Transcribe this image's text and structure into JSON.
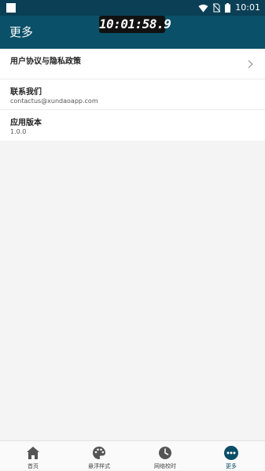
{
  "status_bar": {
    "time": "10:01"
  },
  "clock_overlay": "10:01:58.9",
  "header": {
    "title": "更多"
  },
  "list": [
    {
      "title": "用户协议与隐私政策"
    },
    {
      "title": "联系我们",
      "subtitle": "contactus@xundaoapp.com"
    },
    {
      "title": "应用版本",
      "subtitle": "1.0.0"
    }
  ],
  "tabs": [
    {
      "label": "首页",
      "icon": "home-icon"
    },
    {
      "label": "悬浮样式",
      "icon": "palette-icon"
    },
    {
      "label": "网络校时",
      "icon": "clock-icon"
    },
    {
      "label": "更多",
      "icon": "more-icon",
      "active": true
    }
  ],
  "colors": {
    "primary": "#0a5068",
    "status_bar": "#0a3f55",
    "active_tab": "#0a4d66",
    "inactive_tab": "#555555"
  }
}
